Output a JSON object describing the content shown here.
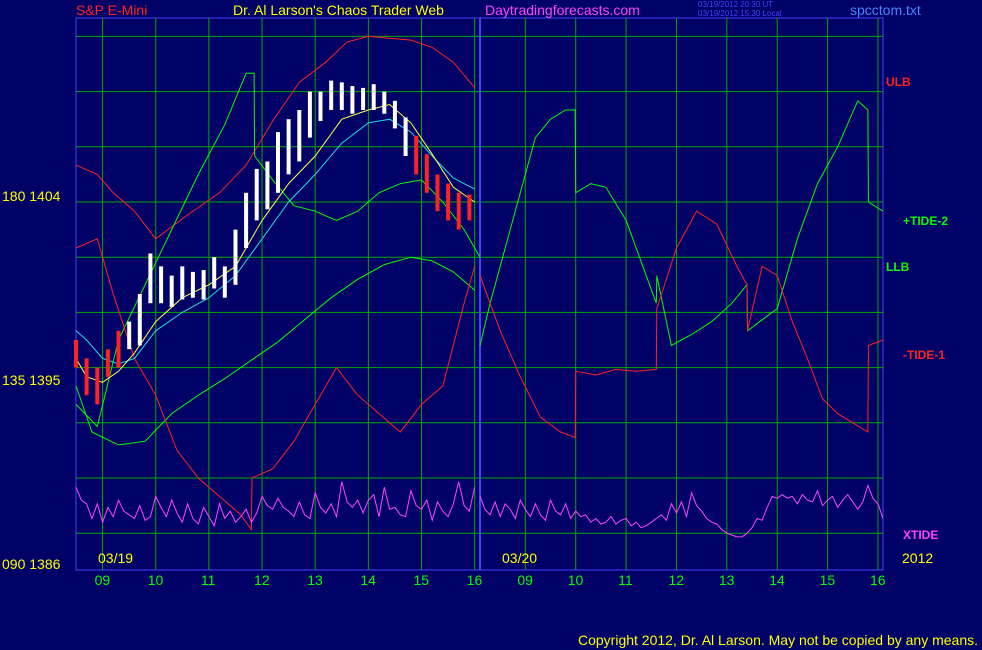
{
  "header": {
    "symbol": "S&P E-Mini",
    "title": "Dr. Al Larson's Chaos Trader Web",
    "site": "Daytradingforecasts.com",
    "stamp_ut": "03/19/2012 20:30 UT",
    "stamp_local": "03/19/2012 15:30 Local",
    "file": "spcctom.txt",
    "colors": {
      "symbol": "#ff2222",
      "title": "#ffff00",
      "site": "#ff44ff",
      "file": "#4488ff"
    }
  },
  "y_labels": [
    "180  1404",
    "135  1395",
    "090  1386"
  ],
  "right_labels": [
    {
      "text": "ULB",
      "color": "#ff2222"
    },
    {
      "text": "+TIDE-2",
      "color": "#00ff00"
    },
    {
      "text": "LLB",
      "color": "#00ff00"
    },
    {
      "text": "-TIDE-1",
      "color": "#ff2222"
    },
    {
      "text": "XTIDE",
      "color": "#ff44ff"
    }
  ],
  "copyright": "Copyright 2012, Dr. Al Larson. May not be copied by any means.",
  "chart_data": {
    "type": "line",
    "title": "S&P E-Mini",
    "ylim": [
      1384,
      1414
    ],
    "y_ticks": [
      1386,
      1395,
      1404
    ],
    "date_labels": [
      "03/19",
      "03/20",
      "2012"
    ],
    "hour_ticks": [
      "09",
      "10",
      "11",
      "12",
      "13",
      "14",
      "15",
      "16",
      "09",
      "10",
      "11",
      "12",
      "13",
      "14",
      "15",
      "16"
    ],
    "x_domain": [
      8.5,
      16.1
    ],
    "day2_offset": 8.1,
    "grid": true,
    "series": [
      {
        "name": "ULB",
        "color": "#ff2222",
        "x": [
          8.5,
          8.9,
          9.2,
          9.6,
          10.0,
          10.6,
          11.2,
          11.7,
          12.2,
          12.7,
          13.2,
          13.6,
          14.0,
          14.4,
          14.8,
          15.2,
          15.6,
          16.0
        ],
        "y": [
          1406.0,
          1405.5,
          1404.5,
          1403.5,
          1402.0,
          1403.3,
          1404.5,
          1406.0,
          1408.4,
          1410.5,
          1411.6,
          1412.7,
          1413.0,
          1412.9,
          1412.8,
          1412.4,
          1411.6,
          1410.2
        ]
      },
      {
        "name": "LLB",
        "color": "#00ff00",
        "x": [
          8.5,
          8.8,
          9.3,
          9.8,
          10.3,
          10.8,
          11.3,
          11.8,
          12.3,
          12.8,
          13.3,
          13.8,
          14.3,
          14.8,
          15.2,
          15.6,
          16.0
        ],
        "y": [
          1394.0,
          1391.5,
          1390.8,
          1391.0,
          1392.5,
          1393.5,
          1394.4,
          1395.4,
          1396.4,
          1397.6,
          1398.8,
          1399.8,
          1400.6,
          1401.0,
          1400.8,
          1400.2,
          1399.2
        ]
      },
      {
        "name": "+TIDE-2 (day 1)",
        "color": "#00ff00",
        "x": [
          8.5,
          8.9,
          9.3,
          9.8,
          10.3,
          10.8,
          11.3,
          11.7,
          11.85,
          11.86,
          12.2,
          12.6,
          13.0,
          13.4,
          13.8,
          14.2,
          14.6,
          15.0,
          15.4,
          15.8,
          16.1
        ],
        "y": [
          1393.0,
          1391.8,
          1396.5,
          1399.5,
          1402.5,
          1405.5,
          1408.2,
          1411.0,
          1411.0,
          1406.5,
          1405.2,
          1403.8,
          1403.5,
          1403.0,
          1403.5,
          1404.5,
          1405.0,
          1405.2,
          1404.0,
          1402.5,
          1401.0
        ]
      },
      {
        "name": "-TIDE-1 (day 1)",
        "color": "#ff2222",
        "x": [
          8.5,
          8.9,
          9.2,
          9.6,
          10.0,
          10.4,
          10.8,
          11.2,
          11.6,
          11.8,
          11.81,
          12.2,
          12.6,
          13.0,
          13.4,
          13.8,
          14.2,
          14.6,
          15.0,
          15.4,
          15.8,
          16.0
        ],
        "y": [
          1401.5,
          1402.0,
          1399.0,
          1395.5,
          1393.5,
          1390.5,
          1389.0,
          1388.0,
          1387.0,
          1386.2,
          1389.0,
          1389.5,
          1391.0,
          1393.0,
          1395.0,
          1393.5,
          1392.5,
          1391.5,
          1393.0,
          1394.0,
          1398.5,
          1400.5
        ]
      },
      {
        "name": "+TIDE-2 (day 2)",
        "color": "#00ff00",
        "x": [
          8.1,
          8.3,
          8.6,
          8.9,
          9.2,
          9.5,
          9.8,
          9.99,
          10.0,
          10.3,
          10.6,
          11.0,
          11.4,
          11.6,
          11.61,
          11.9,
          12.3,
          12.7,
          13.1,
          13.4,
          13.41,
          13.7,
          14.0,
          14.4,
          14.8,
          15.2,
          15.6,
          15.8,
          15.81,
          16.1
        ],
        "y": [
          1396.2,
          1398.5,
          1401.5,
          1404.5,
          1407.5,
          1408.5,
          1409.0,
          1409.0,
          1404.5,
          1405.0,
          1404.8,
          1403.0,
          1400.0,
          1398.5,
          1400.0,
          1396.2,
          1396.8,
          1397.5,
          1398.5,
          1399.5,
          1397.0,
          1397.6,
          1398.2,
          1402.0,
          1405.0,
          1407.0,
          1409.5,
          1409.0,
          1404.0,
          1403.5
        ]
      },
      {
        "name": "-TIDE-1 (day 2)",
        "color": "#ff2222",
        "x": [
          8.1,
          8.5,
          8.9,
          9.3,
          9.7,
          9.99,
          10.0,
          10.4,
          10.8,
          11.2,
          11.6,
          11.61,
          12.0,
          12.4,
          12.8,
          13.2,
          13.4,
          13.41,
          13.7,
          14.0,
          14.3,
          14.6,
          14.9,
          15.2,
          15.5,
          15.8,
          15.81,
          16.1
        ],
        "y": [
          1400.0,
          1397.0,
          1394.5,
          1392.3,
          1391.5,
          1391.2,
          1394.8,
          1394.6,
          1394.9,
          1394.8,
          1394.9,
          1398.2,
          1401.5,
          1403.5,
          1402.8,
          1400.5,
          1399.5,
          1397.0,
          1400.5,
          1400.0,
          1397.5,
          1395.5,
          1393.3,
          1392.5,
          1392.0,
          1391.5,
          1396.2,
          1396.5
        ]
      },
      {
        "name": "XTIDE (day 1)",
        "color": "#ff44ff",
        "x": [
          8.5,
          8.6,
          8.7,
          8.8,
          8.9,
          9.0,
          9.1,
          9.2,
          9.3,
          9.4,
          9.5,
          9.6,
          9.7,
          9.8,
          9.9,
          10.0,
          10.1,
          10.2,
          10.3,
          10.4,
          10.5,
          10.6,
          10.7,
          10.8,
          10.9,
          11.0,
          11.1,
          11.2,
          11.3,
          11.4,
          11.5,
          11.6,
          11.7,
          11.8,
          11.9,
          12.0,
          12.1,
          12.2,
          12.3,
          12.4,
          12.5,
          12.6,
          12.7,
          12.8,
          12.9,
          13.0,
          13.1,
          13.2,
          13.3,
          13.4,
          13.5,
          13.6,
          13.7,
          13.8,
          13.9,
          14.0,
          14.1,
          14.2,
          14.3,
          14.4,
          14.5,
          14.6,
          14.7,
          14.8,
          14.9,
          15.0,
          15.1,
          15.2,
          15.3,
          15.4,
          15.5,
          15.6,
          15.7,
          15.8,
          15.9,
          16.0
        ],
        "y": [
          1388.5,
          1387.8,
          1387.6,
          1386.8,
          1387.6,
          1386.6,
          1387.4,
          1386.9,
          1387.8,
          1387.2,
          1387.0,
          1386.8,
          1387.5,
          1386.7,
          1386.9,
          1388.0,
          1387.4,
          1386.9,
          1387.8,
          1387.1,
          1386.6,
          1387.6,
          1386.8,
          1386.5,
          1387.4,
          1386.9,
          1386.4,
          1387.6,
          1386.8,
          1387.2,
          1386.6,
          1386.9,
          1387.3,
          1386.6,
          1387.1,
          1388.0,
          1387.5,
          1387.3,
          1387.9,
          1387.4,
          1387.2,
          1386.9,
          1387.7,
          1387.0,
          1386.8,
          1388.2,
          1387.4,
          1387.1,
          1387.6,
          1386.9,
          1388.8,
          1387.7,
          1387.4,
          1387.8,
          1387.1,
          1387.8,
          1388.1,
          1386.9,
          1388.5,
          1387.3,
          1387.4,
          1387.0,
          1386.9,
          1388.3,
          1387.5,
          1387.3,
          1387.8,
          1386.7,
          1387.7,
          1387.2,
          1386.9,
          1387.6,
          1388.8,
          1387.5,
          1387.2,
          1388.5
        ]
      },
      {
        "name": "XTIDE (day 2)",
        "color": "#ff44ff",
        "x": [
          8.1,
          8.2,
          8.3,
          8.4,
          8.5,
          8.6,
          8.7,
          8.8,
          8.9,
          9.0,
          9.1,
          9.2,
          9.3,
          9.4,
          9.5,
          9.6,
          9.7,
          9.8,
          9.9,
          10.0,
          10.1,
          10.2,
          10.3,
          10.4,
          10.5,
          10.6,
          10.7,
          10.8,
          10.9,
          11.0,
          11.1,
          11.2,
          11.3,
          11.4,
          11.5,
          11.6,
          11.7,
          11.8,
          11.9,
          12.0,
          12.1,
          12.2,
          12.3,
          12.4,
          12.5,
          12.6,
          12.7,
          12.8,
          12.9,
          13.0,
          13.1,
          13.2,
          13.3,
          13.4,
          13.5,
          13.6,
          13.7,
          13.8,
          13.9,
          14.0,
          14.1,
          14.2,
          14.3,
          14.4,
          14.5,
          14.6,
          14.7,
          14.8,
          14.9,
          15.0,
          15.1,
          15.2,
          15.3,
          15.4,
          15.5,
          15.6,
          15.7,
          15.8,
          15.9,
          16.0,
          16.1
        ],
        "y": [
          1388.0,
          1387.3,
          1387.0,
          1387.7,
          1386.9,
          1387.6,
          1387.3,
          1386.8,
          1387.8,
          1387.3,
          1386.9,
          1387.6,
          1387.0,
          1386.7,
          1387.8,
          1387.2,
          1387.0,
          1387.6,
          1386.8,
          1387.2,
          1386.9,
          1387.0,
          1386.6,
          1386.8,
          1386.5,
          1386.6,
          1386.9,
          1386.5,
          1386.7,
          1386.8,
          1386.4,
          1386.6,
          1386.3,
          1386.4,
          1386.6,
          1386.8,
          1387.0,
          1386.7,
          1387.6,
          1387.1,
          1387.7,
          1386.9,
          1388.2,
          1387.5,
          1387.2,
          1386.8,
          1386.6,
          1386.5,
          1386.2,
          1386.0,
          1385.9,
          1385.8,
          1385.8,
          1386.0,
          1386.3,
          1386.8,
          1386.7,
          1387.4,
          1388.0,
          1387.9,
          1388.1,
          1387.9,
          1388.0,
          1387.6,
          1388.1,
          1387.8,
          1387.7,
          1388.3,
          1387.5,
          1387.8,
          1388.0,
          1387.4,
          1387.8,
          1388.1,
          1387.7,
          1387.3,
          1387.7,
          1388.6,
          1387.9,
          1387.6,
          1386.8
        ]
      },
      {
        "name": "average (cyan)",
        "color": "#22dddd",
        "x": [
          8.5,
          8.7,
          9.0,
          9.3,
          9.6,
          10.0,
          10.5,
          11.0,
          11.5,
          12.0,
          12.5,
          13.0,
          13.5,
          14.0,
          14.4,
          14.8,
          15.2,
          15.6,
          16.0
        ],
        "y": [
          1397.0,
          1396.5,
          1395.5,
          1395.2,
          1395.5,
          1397.0,
          1398.0,
          1398.8,
          1400.0,
          1402.0,
          1404.0,
          1405.5,
          1407.2,
          1408.3,
          1408.5,
          1407.8,
          1406.5,
          1405.3,
          1404.7
        ]
      },
      {
        "name": "average (yellow)",
        "color": "#ffff44",
        "x": [
          8.5,
          8.7,
          9.0,
          9.3,
          9.6,
          10.0,
          10.5,
          11.0,
          11.5,
          12.0,
          12.5,
          13.0,
          13.5,
          14.0,
          14.4,
          14.8,
          15.2,
          15.6,
          16.0
        ],
        "y": [
          1395.5,
          1394.5,
          1394.2,
          1394.8,
          1395.8,
          1397.5,
          1398.8,
          1399.5,
          1400.5,
          1403.0,
          1405.0,
          1406.5,
          1408.5,
          1409.0,
          1409.3,
          1408.3,
          1406.6,
          1404.8,
          1404.0
        ]
      }
    ],
    "bars": [
      {
        "x": [
          8.5,
          8.7,
          8.9,
          9.1,
          9.3,
          9.5,
          9.7,
          9.9,
          10.1,
          10.3,
          10.5,
          10.7,
          10.9,
          11.1,
          11.3,
          11.5,
          11.7,
          11.9,
          12.1,
          12.3,
          12.5,
          12.7,
          12.9,
          13.1,
          13.3,
          13.5,
          13.7,
          13.9,
          14.1,
          14.3,
          14.5,
          14.7,
          14.9,
          15.1,
          15.3,
          15.5,
          15.7,
          15.9
        ],
        "low": [
          1395.0,
          1393.5,
          1393.0,
          1394.5,
          1395.0,
          1396.0,
          1396.2,
          1398.5,
          1398.5,
          1398.3,
          1398.7,
          1398.8,
          1398.7,
          1399.3,
          1398.8,
          1399.5,
          1401.5,
          1403.0,
          1403.6,
          1404.5,
          1405.5,
          1406.2,
          1407.5,
          1408.4,
          1409.0,
          1409.0,
          1408.8,
          1409.0,
          1409.0,
          1408.8,
          1408.0,
          1406.5,
          1405.5,
          1404.5,
          1403.5,
          1403.0,
          1402.5,
          1403.0
        ],
        "high": [
          1396.5,
          1395.5,
          1395.0,
          1396.0,
          1397.0,
          1397.5,
          1399.0,
          1401.2,
          1400.5,
          1400.0,
          1400.5,
          1400.2,
          1400.3,
          1401.0,
          1400.5,
          1402.5,
          1404.5,
          1405.8,
          1406.2,
          1407.8,
          1408.5,
          1409.0,
          1410.0,
          1410.0,
          1410.6,
          1410.5,
          1410.3,
          1410.2,
          1410.4,
          1410.0,
          1409.5,
          1408.6,
          1407.6,
          1406.6,
          1405.5,
          1405.0,
          1404.5,
          1404.4
        ],
        "color": [
          "#ff2222",
          "#ff2222",
          "#ff2222",
          "#ff2222",
          "#ff2222",
          "#ffffff",
          "#ffffff",
          "#ffffff",
          "#ffffff",
          "#ffffff",
          "#ffffff",
          "#ffffff",
          "#ffffff",
          "#ffffff",
          "#ffffff",
          "#ffffff",
          "#ffffff",
          "#ffffff",
          "#ffffff",
          "#ffffff",
          "#ffffff",
          "#ffffff",
          "#ffffff",
          "#ffffff",
          "#ffffff",
          "#ffffff",
          "#ffffff",
          "#ffffff",
          "#ffffff",
          "#ffffff",
          "#ffffff",
          "#ffffff",
          "#ff2222",
          "#ff2222",
          "#ff2222",
          "#ff2222",
          "#ff2222",
          "#ff2222"
        ]
      }
    ]
  }
}
